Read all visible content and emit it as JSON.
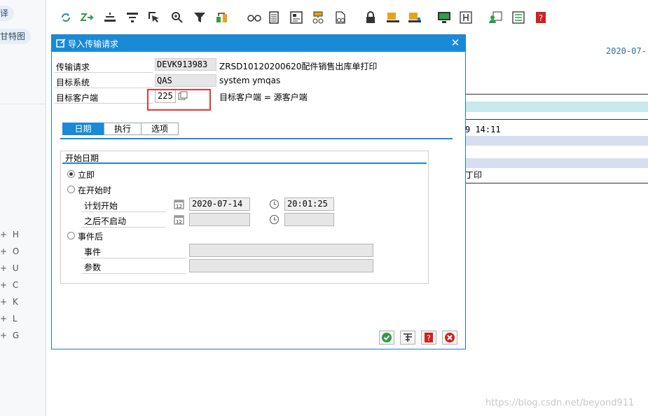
{
  "sidebar": {
    "chips": [
      "译",
      "甘特图"
    ],
    "tree_items": [
      {
        "plus": "+",
        "label": "H"
      },
      {
        "plus": "+",
        "label": "O"
      },
      {
        "plus": "+",
        "label": "U"
      },
      {
        "plus": "+",
        "label": "C"
      },
      {
        "plus": "+",
        "label": "K"
      },
      {
        "plus": "+",
        "label": "L"
      },
      {
        "plus": "+",
        "label": "G"
      }
    ]
  },
  "toolbar": {
    "icons": [
      "refresh-icon",
      "execute-icon",
      "sort-ascending-icon",
      "filter-icon",
      "select-icon",
      "zoom-icon",
      "funnel-icon",
      "transport-icon",
      "glasses-icon",
      "document-icon",
      "layout-icon",
      "hierarchy-icon",
      "check-doc-icon",
      "lock-icon",
      "truck-icon",
      "truck-display-icon",
      "monitor-icon",
      "header-icon",
      "user-card-icon",
      "list-icon",
      "help-icon"
    ]
  },
  "background": {
    "date": "2020-07-",
    "time_text": "9 14:11",
    "print_text": "丁印"
  },
  "dialog": {
    "title": "导入传输请求",
    "close": "✕",
    "fields": {
      "request_label": "传输请求",
      "request_value": "DEVK913983",
      "request_desc": "ZRSD10120200620配件销售出库单打印",
      "target_system_label": "目标系统",
      "target_system_value": "QAS",
      "target_system_desc": "system ymqas",
      "target_client_label": "目标客户端",
      "target_client_value": "225",
      "target_client_desc": "目标客户端 = 源客户端"
    },
    "tabs": [
      "日期",
      "执行",
      "选项"
    ],
    "group_title": "开始日期",
    "options": {
      "immediately": "立即",
      "at_start": "在开始时",
      "planned_start": "计划开始",
      "planned_date": "2020-07-14",
      "planned_time": "20:01:25",
      "no_start_after": "之后不启动",
      "after_event": "事件后",
      "event": "事件",
      "parameter": "参数"
    },
    "buttons": [
      "confirm-icon",
      "tree-icon",
      "help-icon",
      "cancel-icon"
    ]
  },
  "watermark": "https://blog.csdn.net/beyond911",
  "colors": {
    "title_bar": "#1a8ad6",
    "highlight_box": "#e53935",
    "band_teal": "#c8e9ee",
    "band_blue": "#d5dff0"
  }
}
